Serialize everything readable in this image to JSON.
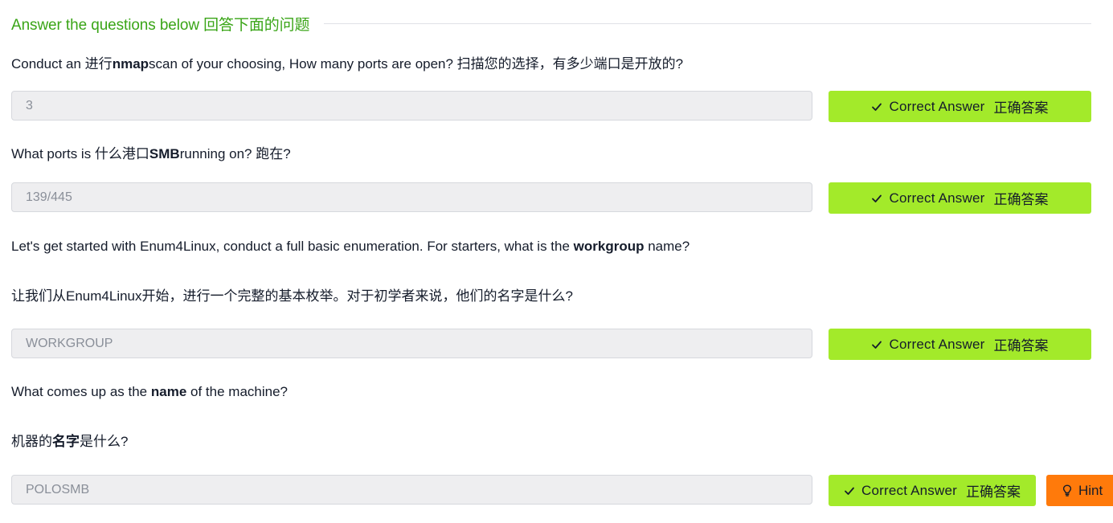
{
  "section": {
    "title": "Answer the questions below 回答下面的问题"
  },
  "questions": [
    {
      "text_a": "Conduct an 进行",
      "text_b": "nmap",
      "text_c": "scan of your choosing, How many ports are open? 扫描您的选择，有多少端口是开放的?",
      "answer": "3",
      "button_en": "Correct Answer",
      "button_zh": "正确答案"
    },
    {
      "text_a": "What ports is 什么港口",
      "text_b": "SMB",
      "text_c": "running on? 跑在?",
      "answer": "139/445",
      "button_en": "Correct Answer",
      "button_zh": "正确答案"
    },
    {
      "text_a": "Let's get started with Enum4Linux, conduct a full basic enumeration. For starters, what is the ",
      "text_b": "workgroup",
      "text_c": " name?",
      "text_zh": "让我们从Enum4Linux开始，进行一个完整的基本枚举。对于初学者来说，他们的名字是什么?",
      "answer": "WORKGROUP",
      "button_en": "Correct Answer",
      "button_zh": "正确答案"
    },
    {
      "text_a": "What comes up as the ",
      "text_b": "name",
      "text_c": " of the machine?",
      "text_zh_a": "机器的",
      "text_zh_b": "名字",
      "text_zh_c": "是什么?",
      "answer": "POLOSMB",
      "button_en": "Correct Answer",
      "button_zh": "正确答案",
      "hint_label": "Hint"
    }
  ],
  "colors": {
    "title_green": "#3aa517",
    "correct_button": "#a3ea2a",
    "hint_button": "#ff7a0b"
  },
  "icons": {
    "correct": "check-icon",
    "hint": "lightbulb-icon"
  }
}
